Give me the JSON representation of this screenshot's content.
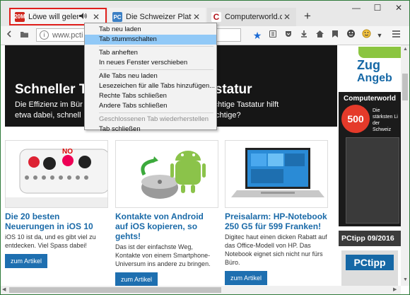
{
  "tabs": [
    {
      "favicon": "20M",
      "title": "Löwe will gelernt ...",
      "has_audio": true,
      "close": "✕"
    },
    {
      "favicon": "PC",
      "title": "Die Schweizer Plattfor...",
      "close": "✕"
    },
    {
      "favicon": "C",
      "title": "Computerworld.ch - ...",
      "close": "✕"
    }
  ],
  "new_tab_label": "+",
  "window_controls": [
    "—",
    "☐",
    "✕"
  ],
  "navbar": {
    "url": "www.pcti",
    "icons": [
      "back-icon",
      "forward-icon",
      "folder-icon",
      "info-icon",
      "bookmark-star-icon",
      "reading-list-icon",
      "pocket-icon",
      "download-icon",
      "home-icon",
      "save-icon",
      "emoji-icon",
      "emoji-addon-icon",
      "menu-icon"
    ]
  },
  "context_menu": {
    "items": [
      {
        "label": "Tab neu laden",
        "highlighted": false,
        "disabled": false
      },
      {
        "label": "Tab stummschalten",
        "highlighted": true,
        "disabled": false
      },
      {
        "separator": true
      },
      {
        "label": "Tab anheften",
        "highlighted": false,
        "disabled": false
      },
      {
        "label": "In neues Fenster verschieben",
        "highlighted": false,
        "disabled": false
      },
      {
        "separator": true
      },
      {
        "label": "Alle Tabs neu laden",
        "highlighted": false,
        "disabled": false
      },
      {
        "label": "Lesezeichen für alle Tabs hinzufügen...",
        "highlighted": false,
        "disabled": false
      },
      {
        "label": "Rechte Tabs schließen",
        "highlighted": false,
        "disabled": false
      },
      {
        "label": "Andere Tabs schließen",
        "highlighted": false,
        "disabled": false
      },
      {
        "separator": true
      },
      {
        "label": "Geschlossenen Tab wiederherstellen",
        "highlighted": false,
        "disabled": true
      },
      {
        "label": "Tab schließen",
        "highlighted": false,
        "disabled": false
      }
    ]
  },
  "hero": {
    "title_left": "Schneller Ti",
    "title_right": "Tastatur",
    "desc_line1": "Die Effizienz im Bür",
    "desc_line1_right": "Die richtige Tastatur hilft",
    "desc_line2": "etwa dabei, schnell",
    "desc_line2_right": "die Richtige?"
  },
  "articles": [
    {
      "title": "Die 20 besten Neuerungen in iOS 10",
      "body": "iOS 10 ist da, und es gibt viel zu entdecken. Viel Spass dabei!",
      "button": "zum Artikel"
    },
    {
      "title": "Kontakte von Android auf iOS kopieren, so gehts!",
      "body": "Das ist der einfachste Weg, Kontakte von einem Smartphone-Universum ins andere zu bringen.",
      "button": "zum Artikel"
    },
    {
      "title": "Preisalarm: HP-Notebook 250 G5 für 599 Franken!",
      "body": "Digitec haut einen dicken Rabatt auf das Office-Modell von HP. Das Notebook eignet sich nicht nur fürs Büro.",
      "button": "zum Artikel"
    }
  ],
  "sidebar": {
    "banner_text_1": "Zug",
    "banner_text_2": "Angeb",
    "magazine_brand": "Computerworld",
    "magazine_number": "500",
    "magazine_caption": "Die stärksten Li der Schweiz",
    "pctipp_label": "PCtipp 09/2016",
    "pctipp_brand": "PCtipp"
  }
}
